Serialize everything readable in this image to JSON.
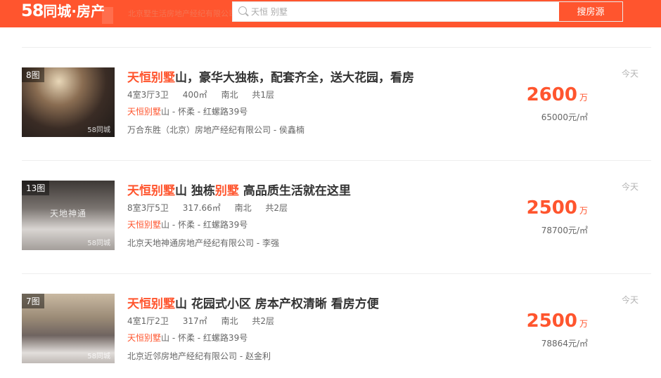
{
  "header": {
    "logo_num": "58",
    "logo_text": "同城·房产",
    "ghost_text": "北京墅生活房地产经纪有限公司",
    "search_placeholder": "天恒 别墅",
    "search_button": "搜房源",
    "brand_color": "#ff552e"
  },
  "listings": [
    {
      "photo_count": "8图",
      "watermark": "58同城",
      "title_parts": [
        {
          "text": "天恒别墅",
          "hl": true
        },
        {
          "text": "山，豪华大独栋，配套齐全，送大花园，看房",
          "hl": false
        }
      ],
      "layout": "4室3厅3卫",
      "area": "400㎡",
      "orientation": "南北",
      "floors": "共1层",
      "addr_name": "天恒别墅",
      "addr_rest": "山  - 怀柔  - 红螺路39号",
      "agency": "万合东胜（北京）房地产经纪有限公司 - 侯鑫楠",
      "date": "今天",
      "price": "2600",
      "price_unit": "万",
      "unit_price": "65000元/㎡"
    },
    {
      "photo_count": "13图",
      "watermark": "58同城",
      "sign_text": "天地神通",
      "title_parts": [
        {
          "text": "天恒别墅",
          "hl": true
        },
        {
          "text": "山 独栋",
          "hl": false
        },
        {
          "text": "别墅",
          "hl": true
        },
        {
          "text": " 高品质生活就在这里",
          "hl": false
        }
      ],
      "layout": "8室3厅5卫",
      "area": "317.66㎡",
      "orientation": "南北",
      "floors": "共2层",
      "addr_name": "天恒别墅",
      "addr_rest": "山  - 怀柔  - 红螺路39号",
      "agency": "北京天地神通房地产经纪有限公司 - 李强",
      "date": "今天",
      "price": "2500",
      "price_unit": "万",
      "unit_price": "78700元/㎡"
    },
    {
      "photo_count": "7图",
      "watermark": "58同城",
      "title_parts": [
        {
          "text": "天恒别墅",
          "hl": true
        },
        {
          "text": "山 花园式小区 房本产权清晰 看房方便",
          "hl": false
        }
      ],
      "layout": "4室1厅2卫",
      "area": "317㎡",
      "orientation": "南北",
      "floors": "共2层",
      "addr_name": "天恒别墅",
      "addr_rest": "山  - 怀柔  - 红螺路39号",
      "agency": "北京近邻房地产经纪有限公司 - 赵金利",
      "date": "今天",
      "price": "2500",
      "price_unit": "万",
      "unit_price": "78864元/㎡"
    }
  ]
}
